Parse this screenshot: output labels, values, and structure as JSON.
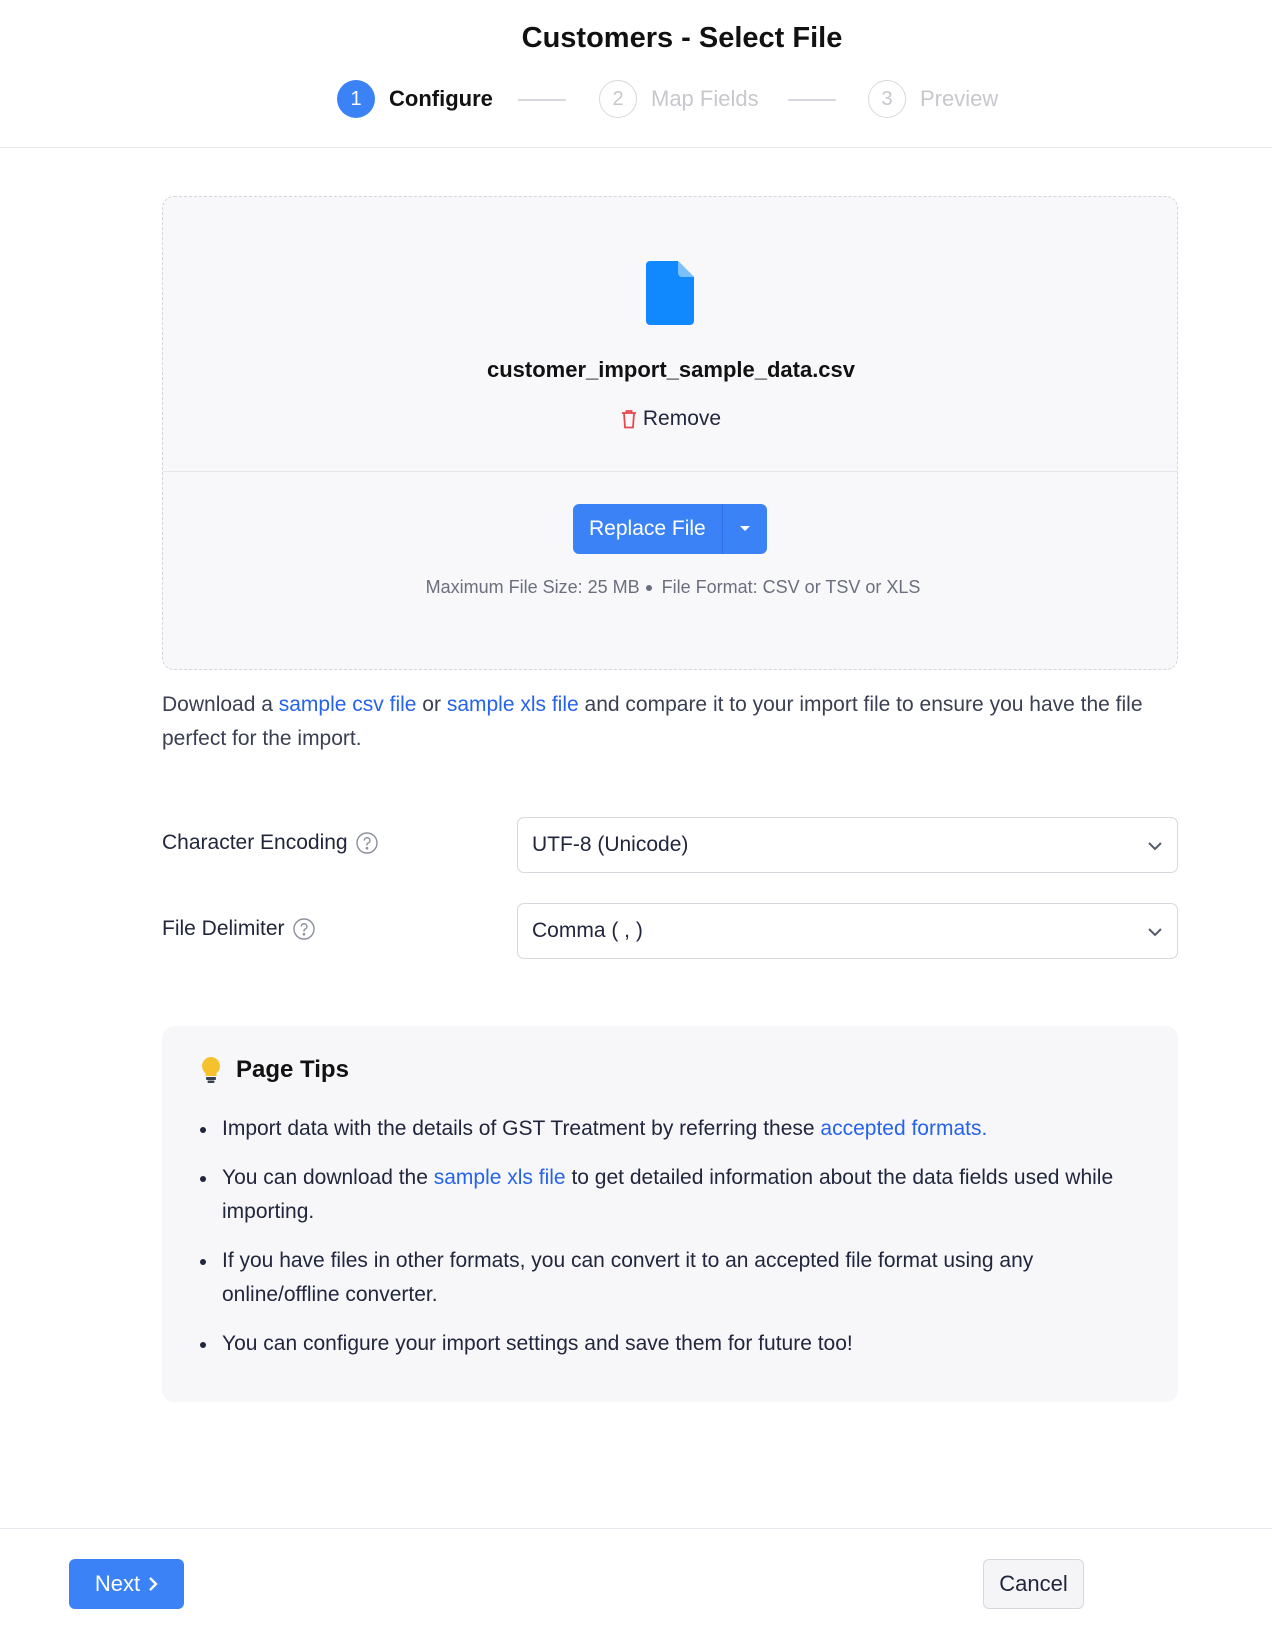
{
  "header": {
    "title": "Customers - Select File",
    "steps": [
      {
        "number": "1",
        "label": "Configure",
        "state": "active"
      },
      {
        "number": "2",
        "label": "Map Fields",
        "state": "inactive"
      },
      {
        "number": "3",
        "label": "Preview",
        "state": "inactive"
      }
    ]
  },
  "upload": {
    "file_icon": "document-icon",
    "file_name": "customer_import_sample_data.csv",
    "remove_label": "Remove",
    "replace_label": "Replace File",
    "max_size": "Maximum File Size: 25 MB",
    "format": "File Format: CSV or TSV or XLS"
  },
  "sample": {
    "prefix": "Download a ",
    "csv_link": "sample csv file",
    "or": " or ",
    "xls_link": "sample xls file",
    "suffix": " and compare it to your import file to ensure you have the file perfect for the import."
  },
  "form": {
    "encoding_label": "Character Encoding",
    "encoding_value": "UTF-8 (Unicode)",
    "delimiter_label": "File Delimiter",
    "delimiter_value": "Comma ( , )"
  },
  "tips": {
    "title": "Page Tips",
    "tip1_text": "Import data with the details of GST Treatment by referring these ",
    "tip1_link": "accepted formats.",
    "tip2_prefix": "You can download the ",
    "tip2_link": "sample xls file",
    "tip2_suffix": " to get detailed information about the data fields used while importing.",
    "tip3": "If you have files in other formats, you can convert it to an accepted file format using any online/offline converter.",
    "tip4": "You can configure your import settings and save them for future too!"
  },
  "footer": {
    "next_label": "Next",
    "cancel_label": "Cancel"
  },
  "colors": {
    "accent": "#3b82f6",
    "link": "#2563eb",
    "file_icon": "#1089ff",
    "remove_icon": "#e5484d"
  }
}
